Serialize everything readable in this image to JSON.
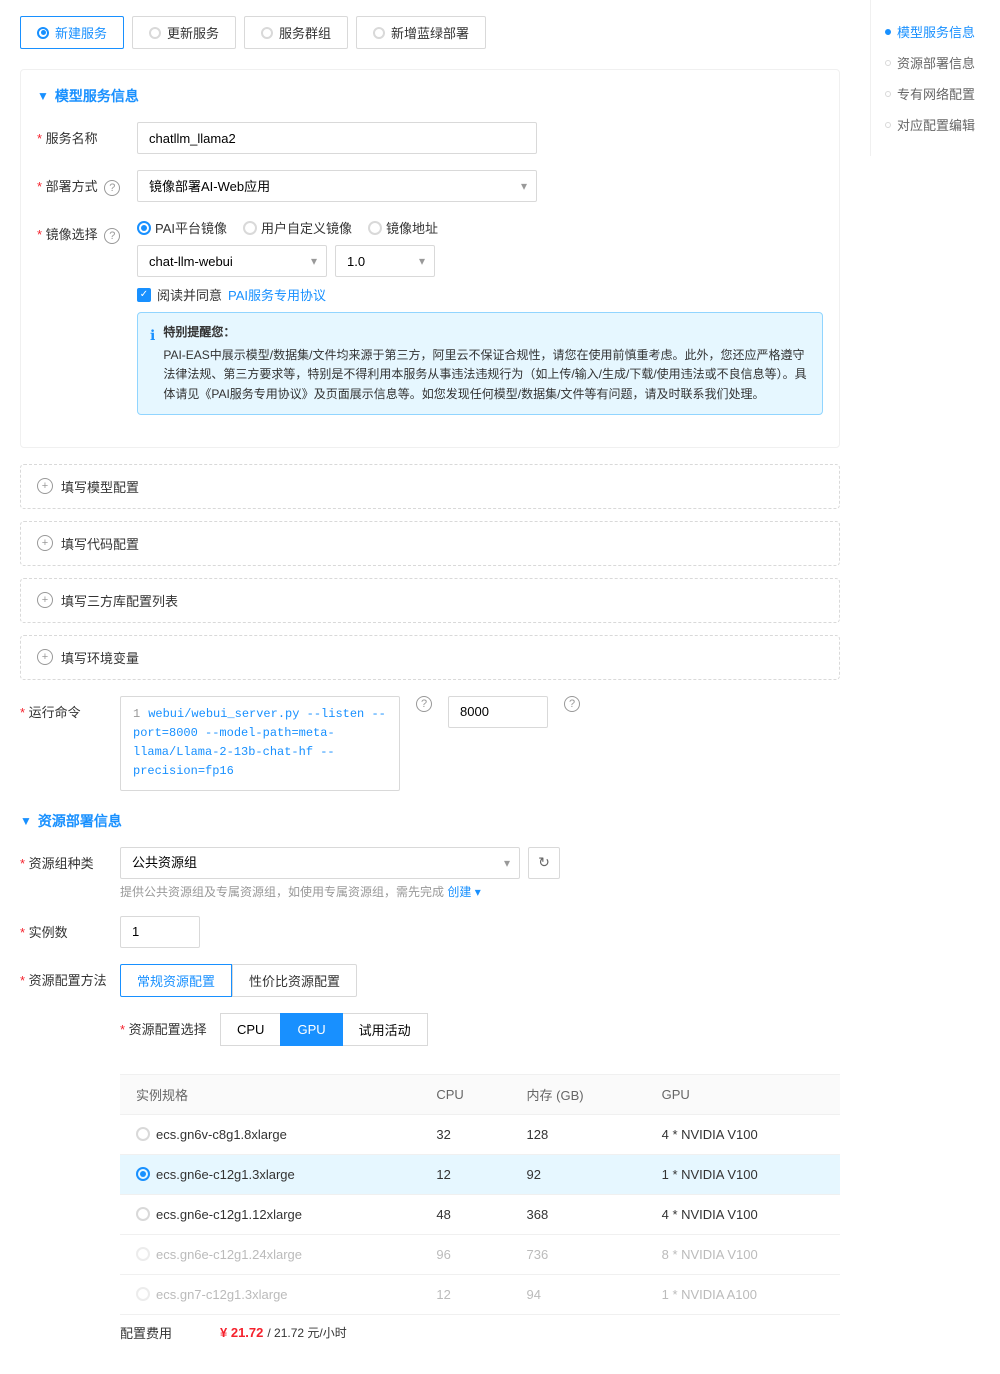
{
  "tabs": [
    {
      "id": "new-service",
      "label": "新建服务",
      "active": true
    },
    {
      "id": "update-service",
      "label": "更新服务",
      "active": false
    },
    {
      "id": "service-group",
      "label": "服务群组",
      "active": false
    },
    {
      "id": "blue-green",
      "label": "新增蓝绿部署",
      "active": false
    }
  ],
  "model_info_section": {
    "title": "模型服务信息",
    "fields": {
      "service_name": {
        "label": "服务名称",
        "value": "chatllm_llama2"
      },
      "deploy_method": {
        "label": "部署方式",
        "value": "镜像部署AI-Web应用",
        "help": true
      },
      "image_select": {
        "label": "镜像选择",
        "help": true,
        "options": [
          {
            "id": "pai",
            "label": "PAI平台镜像",
            "checked": true
          },
          {
            "id": "custom",
            "label": "用户自定义镜像",
            "checked": false
          },
          {
            "id": "address",
            "label": "镜像地址",
            "checked": false
          }
        ],
        "image_value": "chat-llm-webui",
        "version_value": "1.0"
      },
      "agreement": {
        "label": "阅读并同意",
        "link_text": "PAI服务专用协议",
        "checked": true
      },
      "notice": {
        "title": "特别提醒您：",
        "content": "PAI-EAS中展示模型/数据集/文件均来源于第三方，阿里云不保证合规性，请您在使用前慎重考虑。此外，您还应严格遵守法律法规、第三方要求等，特别是不得利用本服务从事违法违规行为（如上传/输入/生成/下载/使用违法或不良信息等）。具体请见《PAI服务专用协议》及页面展示信息等。如您发现任何模型/数据集/文件等有问题，请及时联系我们处理。"
      }
    }
  },
  "collapsible_sections": [
    {
      "id": "model-config",
      "label": "填写模型配置"
    },
    {
      "id": "code-config",
      "label": "填写代码配置"
    },
    {
      "id": "third-party",
      "label": "填写三方库配置列表"
    },
    {
      "id": "env-vars",
      "label": "填写环境变量"
    }
  ],
  "run_command": {
    "label": "运行命令",
    "line_number": "1",
    "command_text": "webui/webui_server.py --listen --port=8000 --model-path=meta-llama/Llama-2-13b-chat-hf --precision=fp16",
    "port_value": "8000"
  },
  "resource_section": {
    "title": "资源部署信息",
    "resource_group": {
      "label": "资源组种类",
      "value": "公共资源组",
      "help_text": "提供公共资源组及专属资源组，如使用专属资源组，需先完成",
      "create_link": "创建",
      "dropdown": "▾"
    },
    "instance_count": {
      "label": "实例数",
      "value": "1"
    },
    "resource_config_method": {
      "label": "资源配置方法",
      "tabs": [
        {
          "id": "normal",
          "label": "常规资源配置",
          "active": true
        },
        {
          "id": "cost-effective",
          "label": "性价比资源配置",
          "active": false
        }
      ]
    },
    "resource_config_select": {
      "label": "资源配置选择",
      "types": [
        {
          "id": "cpu",
          "label": "CPU",
          "active": false
        },
        {
          "id": "gpu",
          "label": "GPU",
          "active": true
        },
        {
          "id": "trial",
          "label": "试用活动",
          "active": false
        }
      ]
    },
    "table": {
      "headers": [
        "实例规格",
        "CPU",
        "内存 (GB)",
        "GPU"
      ],
      "rows": [
        {
          "id": "ecs.gn6v-c8g1.8xlarge",
          "name": "ecs.gn6v-c8g1.8xlarge",
          "cpu": "32",
          "memory": "128",
          "gpu": "4 * NVIDIA V100",
          "selected": false,
          "disabled": false
        },
        {
          "id": "ecs.gn6e-c12g1.3xlarge",
          "name": "ecs.gn6e-c12g1.3xlarge",
          "cpu": "12",
          "memory": "92",
          "gpu": "1 * NVIDIA V100",
          "selected": true,
          "disabled": false
        },
        {
          "id": "ecs.gn6e-c12g1.12xlarge",
          "name": "ecs.gn6e-c12g1.12xlarge",
          "cpu": "48",
          "memory": "368",
          "gpu": "4 * NVIDIA V100",
          "selected": false,
          "disabled": false
        },
        {
          "id": "ecs.gn6e-c12g1.24xlarge",
          "name": "ecs.gn6e-c12g1.24xlarge",
          "cpu": "96",
          "memory": "736",
          "gpu": "8 * NVIDIA V100",
          "selected": false,
          "disabled": true
        },
        {
          "id": "ecs.gn7-c12g1.3xlarge",
          "name": "ecs.gn7-c12g1.3xlarge",
          "cpu": "12",
          "memory": "94",
          "gpu": "1 * NVIDIA A100",
          "selected": false,
          "disabled": true
        }
      ]
    },
    "cost": {
      "label": "配置费用",
      "value": "¥ 21.72",
      "suffix": "/ 21.72 元/小时"
    }
  },
  "right_nav": {
    "items": [
      {
        "id": "model-info",
        "label": "模型服务信息",
        "active": true
      },
      {
        "id": "resource-info",
        "label": "资源部署信息",
        "active": false
      },
      {
        "id": "network-config",
        "label": "专有网络配置",
        "active": false
      },
      {
        "id": "config-edit",
        "label": "对应配置编辑",
        "active": false
      }
    ]
  }
}
